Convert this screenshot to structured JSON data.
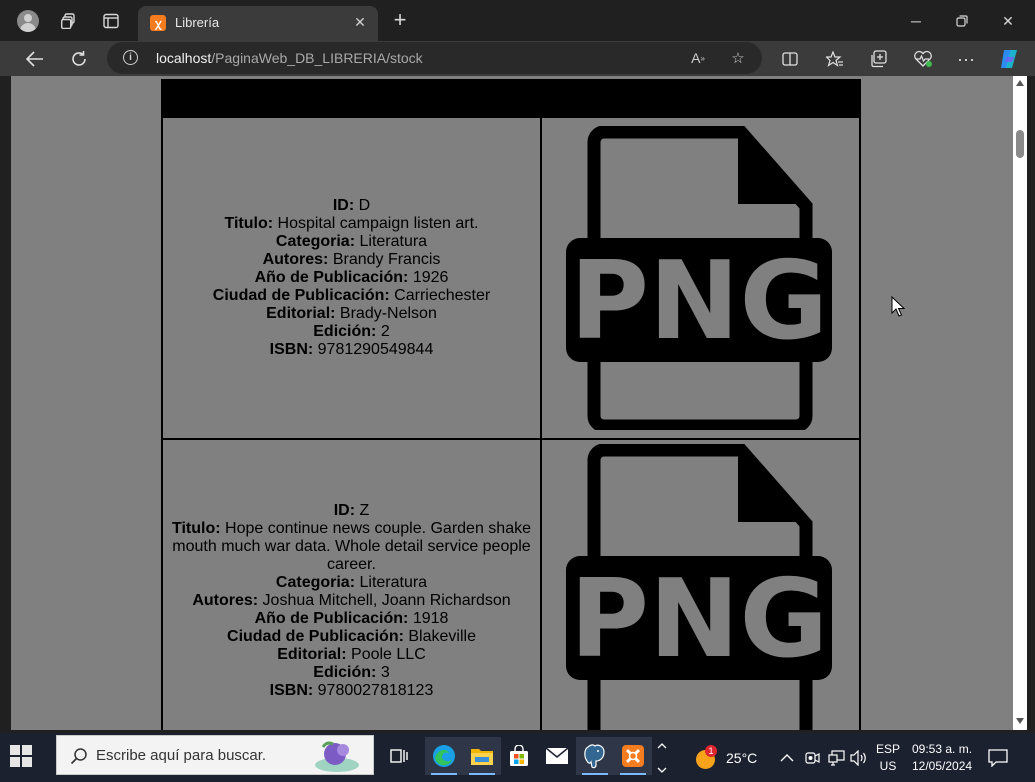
{
  "browser": {
    "tab_title": "Librería",
    "url_host": "localhost",
    "url_path": "/PaginaWeb_DB_LIBRERIA/stock"
  },
  "labels": {
    "id": "ID:",
    "titulo": "Titulo:",
    "categoria": "Categoria:",
    "autores": "Autores:",
    "anio": "Año de Publicación:",
    "ciudad": "Ciudad de Publicación:",
    "editorial": "Editorial:",
    "edicion": "Edición:",
    "isbn": "ISBN:"
  },
  "books": [
    {
      "id": "D",
      "titulo": "Hospital campaign listen art.",
      "categoria": "Literatura",
      "autores": "Brandy Francis",
      "anio": "1926",
      "ciudad": "Carriechester",
      "editorial": "Brady-Nelson",
      "edicion": "2",
      "isbn": "9781290549844",
      "image_text": "PNG"
    },
    {
      "id": "Z",
      "titulo": "Hope continue news couple. Garden shake mouth much war data. Whole detail service people career.",
      "categoria": "Literatura",
      "autores": "Joshua Mitchell, Joann Richardson",
      "anio": "1918",
      "ciudad": "Blakeville",
      "editorial": "Poole LLC",
      "edicion": "3",
      "isbn": "9780027818123",
      "image_text": "PNG"
    }
  ],
  "taskbar": {
    "search_placeholder": "Escribe aquí para buscar.",
    "weather_temp": "25°C",
    "weather_badge": "1",
    "lang_top": "ESP",
    "lang_bottom": "US",
    "time": "09:53 a. m.",
    "date": "12/05/2024"
  },
  "colors": {
    "page_bg": "#808080",
    "header_bg": "#000000",
    "chrome_bg": "#202020",
    "taskbar_bg": "#1c2130",
    "xampp_orange": "#f57c1f"
  }
}
